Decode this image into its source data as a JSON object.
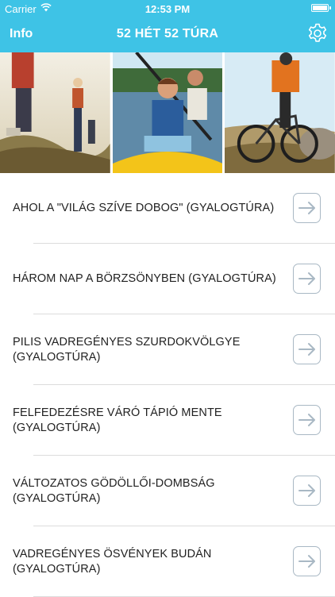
{
  "status_bar": {
    "carrier": "Carrier",
    "time": "12:53 PM"
  },
  "header": {
    "left_button": "Info",
    "title": "52 HÉT 52 TÚRA",
    "settings_icon": "gear-icon"
  },
  "photos": [
    {
      "name": "hikers-photo",
      "subject": "hikers"
    },
    {
      "name": "kayakers-photo",
      "subject": "kayakers"
    },
    {
      "name": "cyclist-photo",
      "subject": "cyclist"
    }
  ],
  "trips": [
    {
      "title": "AHOL A \"VILÁG SZÍVE DOBOG\" (GYALOGTÚRA)"
    },
    {
      "title": "HÁROM NAP A BÖRZSÖNYBEN (GYALOGTÚRA)"
    },
    {
      "title": "PILIS VADREGÉNYES SZURDOKVÖLGYE (GYALOGTÚRA)"
    },
    {
      "title": "FELFEDEZÉSRE VÁRÓ TÁPIÓ MENTE (GYALOGTÚRA)"
    },
    {
      "title": "VÁLTOZATOS GÖDÖLLŐI-DOMBSÁG (GYALOGTÚRA)"
    },
    {
      "title": "VADREGÉNYES ÖSVÉNYEK BUDÁN (GYALOGTÚRA)"
    }
  ],
  "colors": {
    "header": "#3ec3e6",
    "arrow_border": "#a9b8c4",
    "separator": "#dcdcdc"
  },
  "row_icon": "arrow-right-icon"
}
